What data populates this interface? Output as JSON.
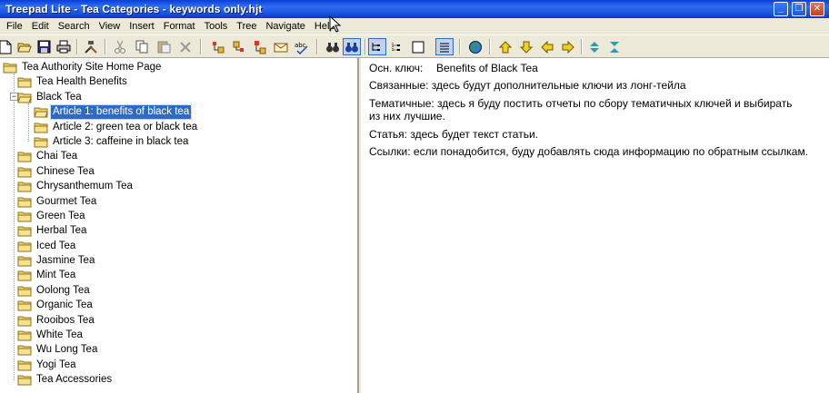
{
  "window": {
    "title": "Treepad Lite - Tea Categories - keywords only.hjt",
    "controls": {
      "minimize": "_",
      "restore": "❐",
      "close": "✕"
    }
  },
  "menu": [
    "File",
    "Edit",
    "Search",
    "View",
    "Insert",
    "Format",
    "Tools",
    "Tree",
    "Navigate",
    "Help"
  ],
  "tree": {
    "root": "Tea Authority Site Home Page",
    "children": [
      {
        "label": "Tea Health Benefits"
      },
      {
        "label": "Black Tea",
        "children": [
          {
            "label": "Article 1: benefits of black tea",
            "selected": true
          },
          {
            "label": "Article 2: green tea or black tea"
          },
          {
            "label": "Article 3: caffeine in black tea"
          }
        ]
      },
      {
        "label": "Chai Tea"
      },
      {
        "label": "Chinese Tea"
      },
      {
        "label": "Chrysanthemum Tea"
      },
      {
        "label": "Gourmet Tea"
      },
      {
        "label": "Green Tea"
      },
      {
        "label": "Herbal Tea"
      },
      {
        "label": "Iced Tea"
      },
      {
        "label": "Jasmine Tea"
      },
      {
        "label": "Mint Tea"
      },
      {
        "label": "Oolong Tea"
      },
      {
        "label": "Organic Tea"
      },
      {
        "label": "Rooibos Tea"
      },
      {
        "label": "White Tea"
      },
      {
        "label": "Wu Long Tea"
      },
      {
        "label": "Yogi Tea"
      },
      {
        "label": "Tea Accessories"
      }
    ]
  },
  "note": {
    "line1_key": "Осн. ключ:",
    "line1_value": "Benefits of Black Tea",
    "line2": "Связанные: здесь будут дополнительные ключи из лонг-тейла",
    "line3a": "Тематичные: здесь я буду постить отчеты по сбору тематичных ключей и выбирать",
    "line3b": "из них лучшие.",
    "line4": "Статья: здесь будет текст статьи.",
    "line5": "Ссылки: если понадобится, буду добавлять сюда информацию по обратным ссылкам."
  },
  "colors": {
    "selection": "#316ac5",
    "titlebar": "#1c55e3",
    "folder": "#f6d86b"
  }
}
